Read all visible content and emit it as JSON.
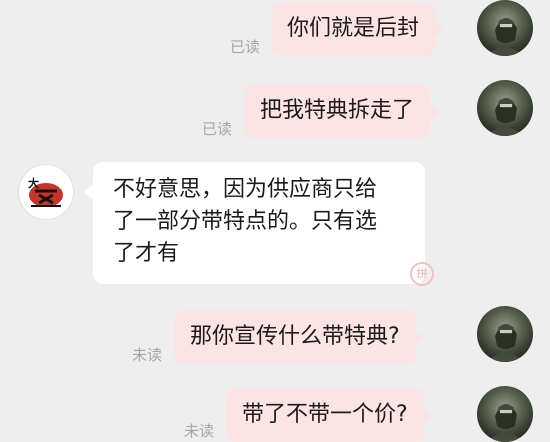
{
  "messages": [
    {
      "side": "out",
      "text": "你们就是后封",
      "status": "已读"
    },
    {
      "side": "out",
      "text": "把我特典拆走了",
      "status": "已读"
    },
    {
      "side": "in",
      "lines": [
        "不好意思，因为供应商只给",
        "了一部分带特点的。只有选",
        "了才有"
      ]
    },
    {
      "side": "out",
      "text": "那你宣传什么带特典?",
      "status": "未读"
    },
    {
      "side": "out",
      "text": "带了不带一个价?",
      "status": "未读"
    }
  ],
  "colors": {
    "outgoing_bubble": "#fde4e4",
    "incoming_bubble": "#ffffff",
    "background": "#eeeeee",
    "status_text": "#a6a6a6"
  },
  "icons": {
    "user_avatar": "user-avatar-icon",
    "shop_avatar": "shop-logo-avatar-icon"
  }
}
